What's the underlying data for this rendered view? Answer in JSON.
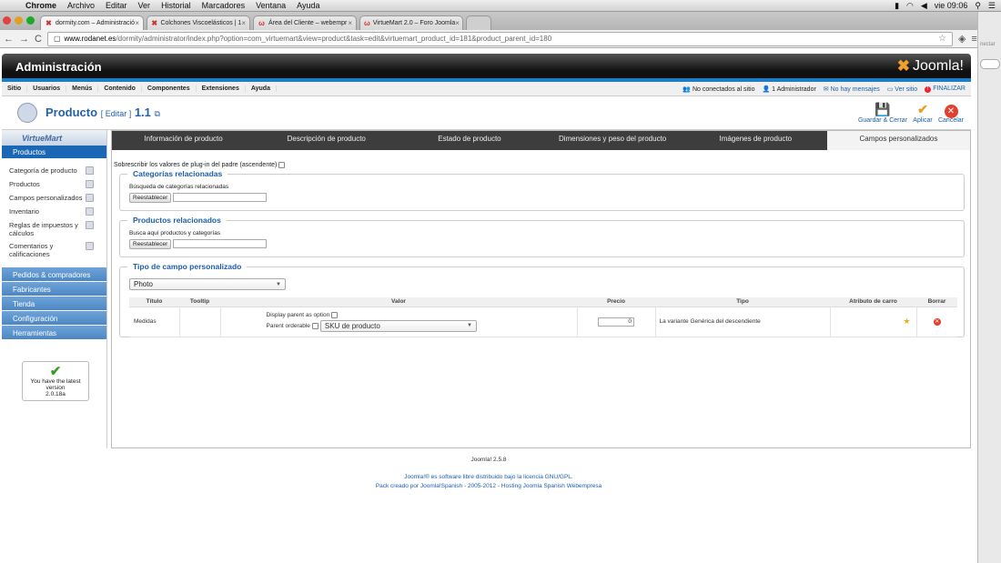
{
  "os": {
    "menus": [
      "Chrome",
      "Archivo",
      "Editar",
      "Ver",
      "Historial",
      "Marcadores",
      "Ventana",
      "Ayuda"
    ],
    "clock": "vie 09:06"
  },
  "browser": {
    "tabs": [
      {
        "label": "dormity.com – Administració"
      },
      {
        "label": "Colchones Viscoelásticos | 1"
      },
      {
        "label": "Área del Cliente – webempr"
      },
      {
        "label": "VirtueMart 2.0 – Foro Joomla"
      }
    ],
    "url_host": "www.rodanet.es",
    "url_rest": "/dormity/administrator/index.php?option=com_virtuemart&view=product&task=edit&virtuemart_product_id=181&product_parent_id=180",
    "side_label": "nectar"
  },
  "header": {
    "title": "Administración",
    "logo": "Joomla!"
  },
  "menubar": {
    "items": [
      "Sitio",
      "Usuarios",
      "Menús",
      "Contenido",
      "Componentes",
      "Extensiones",
      "Ayuda"
    ],
    "status": {
      "visitors": "No conectados al sitio",
      "admins": "1 Administrador",
      "messages": "No hay mensajes",
      "view_site": "Ver sitio",
      "logout": "FINALIZAR"
    }
  },
  "toolbar": {
    "title": "Producto",
    "edit": "[ Editar ]",
    "version": "1.1",
    "buttons": {
      "save_close": "Guardar & Cerrar",
      "apply": "Aplicar",
      "cancel": "Cancelar"
    }
  },
  "sidebar": {
    "logo": "VirtueMart",
    "section": "Productos",
    "items": [
      {
        "label": "Categoría de producto"
      },
      {
        "label": "Productos"
      },
      {
        "label": "Campos personalizados"
      },
      {
        "label": "Inventario"
      },
      {
        "label": "Reglas de impuestos y cálculos"
      },
      {
        "label": "Comentarios y calificaciones"
      }
    ],
    "groups": [
      "Pedidos & compradores",
      "Fabricantes",
      "Tienda",
      "Configuración",
      "Herramientas"
    ],
    "version_box": {
      "line1": "You have the latest version",
      "line2": "2.0.18a"
    }
  },
  "tabs": {
    "labels": [
      "Información de producto",
      "Descripción de producto",
      "Estado de producto",
      "Dimensiones y peso del producto",
      "Imágenes de producto",
      "Campos personalizados"
    ],
    "active": "Campos personalizados"
  },
  "form": {
    "override_label": "Sobrescribir los valores de plug-in del padre (ascendente)",
    "related_categories": {
      "legend": "Categorías relacionadas",
      "label": "Búsqueda de categorías relacionadas",
      "reset": "Reestablecer"
    },
    "related_products": {
      "legend": "Productos relacionados",
      "label": "Busca aquí productos y categorías",
      "reset": "Reestablecer"
    },
    "custom_field": {
      "legend": "Tipo de campo personalizado",
      "selected": "Photo",
      "columns": [
        "Título",
        "Tooltip",
        "Valor",
        "Precio",
        "Tipo",
        "Atributo de carro",
        "Borrar"
      ],
      "row": {
        "title": "Medidas",
        "display_parent": "Display parent as option",
        "parent_orderable": "Parent orderable",
        "sku_select": "SKU de producto",
        "price": "0",
        "type": "La variante Genérica del descendiente"
      }
    }
  },
  "footer": {
    "version": "Joomla! 2.5.8",
    "license": "Joomla!® es software libre distribuido bajo la licencia GNU/GPL.",
    "pack": "Pack creado por Joomla!Spanish - 2005-2012 - Hosting Joomla Spanish Webempresa"
  },
  "colors": {
    "accent": "#1d7ec5",
    "link": "#1d5fa8",
    "sidebar_group": "#4c87c4",
    "header_dark": "#111111"
  }
}
